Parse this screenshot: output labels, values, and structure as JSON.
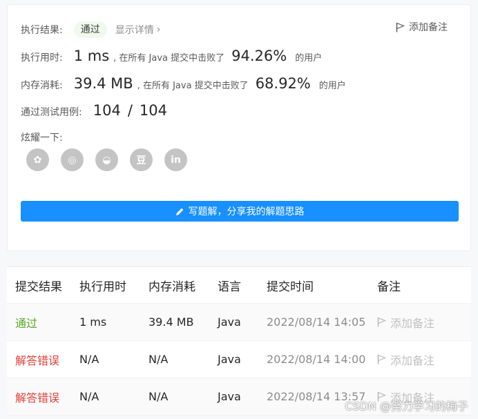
{
  "summary": {
    "result_label": "执行结果:",
    "result_status": "通过",
    "details_link": "显示详情",
    "details_chevron": "›",
    "add_note": "添加备注",
    "runtime": {
      "label": "执行用时:",
      "value": "1 ms",
      "middle": ", 在所有 Java 提交中击败了",
      "percent": "94.26%",
      "suffix": "的用户"
    },
    "memory": {
      "label": "内存消耗:",
      "value": "39.4 MB",
      "middle": ", 在所有 Java 提交中击败了",
      "percent": "68.92%",
      "suffix": "的用户"
    },
    "tests": {
      "label": "通过测试用例:",
      "passed": "104",
      "separator": "/",
      "total": "104"
    },
    "share_label": "炫耀一下:",
    "share_icons": [
      "wechat-icon",
      "weibo-icon",
      "qq-icon",
      "douban-icon",
      "linkedin-icon"
    ],
    "share_glyphs": [
      "✿",
      "◎",
      "◒",
      "豆",
      "in"
    ],
    "write_button": "写题解，分享我的解题思路"
  },
  "table": {
    "headers": [
      "提交结果",
      "执行用时",
      "内存消耗",
      "语言",
      "提交时间",
      "备注"
    ],
    "rows": [
      {
        "result": "通过",
        "runtime": "1 ms",
        "memory": "39.4 MB",
        "language": "Java",
        "time": "2022/08/14 14:05",
        "note": "添加备注"
      },
      {
        "result": "解答错误",
        "runtime": "N/A",
        "memory": "N/A",
        "language": "Java",
        "time": "2022/08/14 14:00",
        "note": "添加备注"
      },
      {
        "result": "解答错误",
        "runtime": "N/A",
        "memory": "N/A",
        "language": "Java",
        "time": "2022/08/14 13:57",
        "note": "添加备注"
      }
    ]
  },
  "watermark": "CSDN @努力学习的梅子",
  "colors": {
    "accent": "#1890ff",
    "pass": "#5aa623",
    "error": "#e0403b"
  }
}
